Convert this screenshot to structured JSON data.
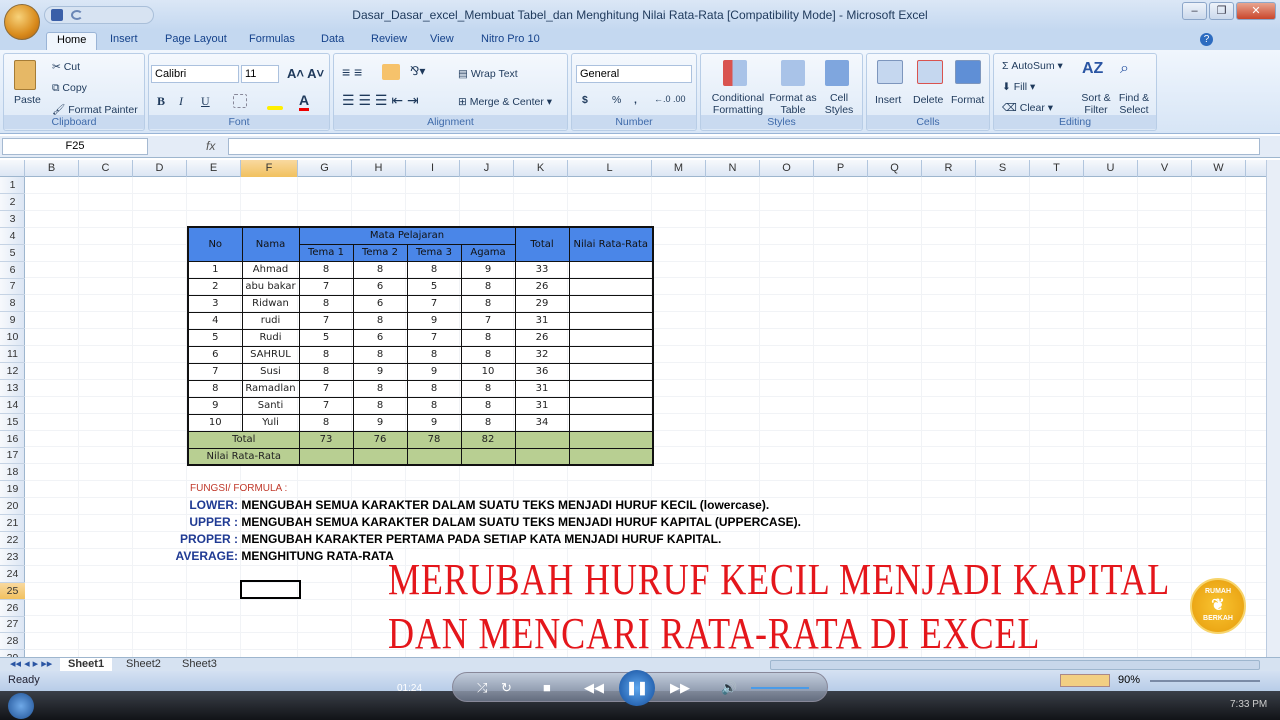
{
  "window": {
    "title": "Dasar_Dasar_excel_Membuat Tabel_dan Menghitung Nilai Rata-Rata  [Compatibility Mode] - Microsoft Excel",
    "controls": [
      "–",
      "❐",
      "✕"
    ]
  },
  "tabs": [
    "Home",
    "Insert",
    "Page Layout",
    "Formulas",
    "Data",
    "Review",
    "View",
    "Nitro Pro 10"
  ],
  "ribbon": {
    "clipboard": {
      "label": "Clipboard",
      "paste": "Paste",
      "cut": "Cut",
      "copy": "Copy",
      "format_painter": "Format Painter"
    },
    "font": {
      "label": "Font",
      "name": "Calibri",
      "size": "11",
      "bold": "B",
      "italic": "I",
      "underline": "U"
    },
    "alignment": {
      "label": "Alignment",
      "wrap": "Wrap Text",
      "merge": "Merge & Center"
    },
    "number": {
      "label": "Number",
      "format": "General",
      "currency": "$",
      "percent": "%",
      "comma": ","
    },
    "styles": {
      "label": "Styles",
      "conditional": "Conditional Formatting",
      "format_table": "Format as Table",
      "cell_styles": "Cell Styles"
    },
    "cells": {
      "label": "Cells",
      "insert": "Insert",
      "delete": "Delete",
      "format": "Format"
    },
    "editing": {
      "label": "Editing",
      "autosum": "AutoSum",
      "fill": "Fill",
      "clear": "Clear",
      "sort": "Sort & Filter",
      "find": "Find & Select"
    }
  },
  "formula_bar": {
    "name_box": "F25",
    "fx": "fx",
    "value": ""
  },
  "columns": [
    "B",
    "C",
    "D",
    "E",
    "F",
    "G",
    "H",
    "I",
    "J",
    "K",
    "L",
    "M",
    "N",
    "O",
    "P",
    "Q",
    "R",
    "S",
    "T",
    "U",
    "V",
    "W"
  ],
  "rows": [
    "1",
    "2",
    "3",
    "4",
    "5",
    "6",
    "7",
    "8",
    "9",
    "10",
    "11",
    "12",
    "13",
    "14",
    "15",
    "16",
    "17",
    "18",
    "19",
    "20",
    "21",
    "22",
    "23",
    "24",
    "25",
    "26",
    "27",
    "28",
    "29"
  ],
  "selected_cell": "F25",
  "table": {
    "headers": {
      "no": "No",
      "nama": "Nama",
      "group": "Mata Pelajaran",
      "total": "Total",
      "avg": "Nilai Rata-Rata",
      "subjects": [
        "Tema 1",
        "Tema 2",
        "Tema 3",
        "Agama"
      ]
    },
    "rows": [
      [
        "1",
        "Ahmad",
        "8",
        "8",
        "8",
        "9",
        "33"
      ],
      [
        "2",
        "abu bakar",
        "7",
        "6",
        "5",
        "8",
        "26"
      ],
      [
        "3",
        "Ridwan",
        "8",
        "6",
        "7",
        "8",
        "29"
      ],
      [
        "4",
        "rudi",
        "7",
        "8",
        "9",
        "7",
        "31"
      ],
      [
        "5",
        "Rudi",
        "5",
        "6",
        "7",
        "8",
        "26"
      ],
      [
        "6",
        "SAHRUL",
        "8",
        "8",
        "8",
        "8",
        "32"
      ],
      [
        "7",
        "Susi",
        "8",
        "9",
        "9",
        "10",
        "36"
      ],
      [
        "8",
        "Ramadlan",
        "7",
        "8",
        "8",
        "8",
        "31"
      ],
      [
        "9",
        "Santi",
        "7",
        "8",
        "8",
        "8",
        "31"
      ],
      [
        "10",
        "Yuli",
        "8",
        "9",
        "9",
        "8",
        "34"
      ]
    ],
    "total_label": "Total",
    "totals": [
      "73",
      "76",
      "78",
      "82"
    ],
    "avg_label": "Nilai Rata-Rata"
  },
  "notes": {
    "heading": "FUNGSI/ FORMULA :",
    "items": [
      {
        "key": "LOWER:",
        "text": "MENGUBAH SEMUA KARAKTER DALAM SUATU TEKS MENJADI HURUF KECIL (lowercase)."
      },
      {
        "key": "UPPER :",
        "text": "MENGUBAH SEMUA KARAKTER DALAM SUATU TEKS MENJADI HURUF KAPITAL (UPPERCASE)."
      },
      {
        "key": "PROPER :",
        "text": "MENGUBAH KARAKTER PERTAMA PADA SETIAP KATA MENJADI HURUF KAPITAL."
      },
      {
        "key": "AVERAGE:",
        "text": "MENGHITUNG RATA-RATA"
      }
    ]
  },
  "overlay": {
    "line1": "MERUBAH HURUF KECIL MENJADI KAPITAL",
    "line2": "DAN MENCARI RATA-RATA DI EXCEL",
    "badge_top": "RUMAH",
    "badge_bottom": "BERKAH"
  },
  "sheet_tabs": [
    "Sheet1",
    "Sheet2",
    "Sheet3"
  ],
  "status": {
    "text": "Ready",
    "zoom": "90%"
  },
  "player": {
    "time": "01:24"
  },
  "taskbar": {
    "clock": "7:33 PM"
  },
  "colors": {
    "header_blue": "#4a86e8",
    "footer_green": "#b8cf92",
    "overlay_red": "#e4161b"
  }
}
